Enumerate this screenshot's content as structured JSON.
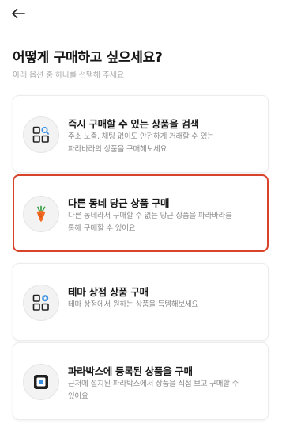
{
  "header": {
    "back_icon": "arrow-left-icon"
  },
  "page": {
    "title": "어떻게 구매하고 싶으세요?",
    "subtitle": "아래 옵션 중 하나를 선택해 주세요"
  },
  "colors": {
    "selected_border": "#d9432a",
    "icon_bg": "#f3f3f3",
    "accent_blue": "#3a8fe0",
    "carrot_orange": "#f26a21"
  },
  "options": [
    {
      "icon": "grid-search-icon",
      "title": "즉시 구매할 수 있는 상품을 검색",
      "desc_line1": "주소 노출, 채팅 없이도 안전하게 거래할 수 있는",
      "desc_line2": "파라바라의 상품을 구매해보세요",
      "selected": false
    },
    {
      "icon": "carrot-icon",
      "title": "다른 동네 당근 상품 구매",
      "desc_line1": "다른 동네라서 구매할 수 없는 당근 상품을 파라바라를",
      "desc_line2": "통해 구매할 수 있어요",
      "selected": true
    },
    {
      "icon": "grid-star-icon",
      "title": "테마 상점 상품 구매",
      "desc_line1": "테마 상점에서 원하는 상품을 득템해보세요",
      "desc_line2": "",
      "selected": false
    },
    {
      "icon": "locker-icon",
      "title": "파라박스에 등록된 상품을 구매",
      "desc_line1": "근처에 설치된 파라박스에서 상품을 직접 보고 구매할 수",
      "desc_line2": "있어요",
      "selected": false
    }
  ]
}
